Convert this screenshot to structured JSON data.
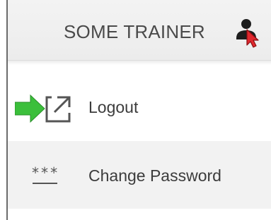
{
  "header": {
    "title": "SOME TRAINER",
    "user_icon": "user-silhouette-icon",
    "cursor_icon": "red-cursor-arrow"
  },
  "menu": {
    "items": [
      {
        "label": "Logout",
        "icon": "logout-external-arrow-icon",
        "indicator": "green-arrow-pointer"
      },
      {
        "label": "Change Password",
        "icon": "password-asterisks-icon",
        "icon_text": "***"
      }
    ]
  },
  "colors": {
    "header_bg": "#efefef",
    "item_alt_bg": "#f2f2f2",
    "text": "#3c3c3c",
    "cursor_red": "#e0282e",
    "indicator_green": "#3bbf3b"
  }
}
